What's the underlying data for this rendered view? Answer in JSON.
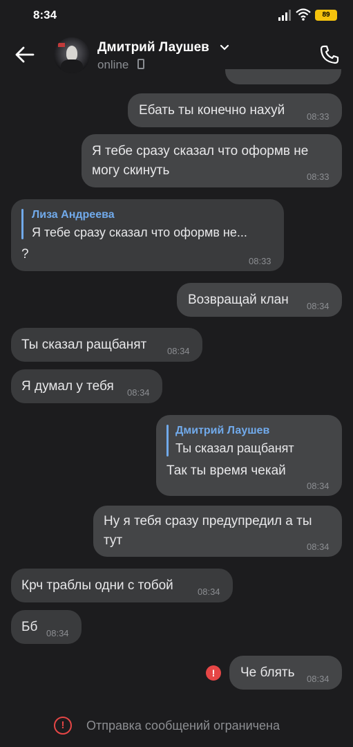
{
  "status_bar": {
    "time": "8:34",
    "battery": "89"
  },
  "header": {
    "contact_name": "Дмитрий Лаушев",
    "status": "online",
    "icons": [
      "back-arrow-icon",
      "chevron-down-icon",
      "mobile-phone-icon",
      "call-icon"
    ]
  },
  "messages": [
    {
      "direction": "out",
      "text": "Ебать ты конечно нахуй",
      "time": "08:33"
    },
    {
      "direction": "out",
      "line1": "Я тебе сразу  сказал что оформв не",
      "line2": "могу скинуть",
      "time": "08:33"
    },
    {
      "direction": "in",
      "reply_name": "Лиза Андреева",
      "reply_text": "Я тебе сразу  сказал что оформв не...",
      "text": "?",
      "time": "08:33"
    },
    {
      "direction": "out",
      "text": "Возвращай клан",
      "time": "08:34"
    },
    {
      "direction": "in",
      "text": "Ты сказал ращбанят",
      "time": "08:34"
    },
    {
      "direction": "in",
      "text": "Я думал у тебя",
      "time": "08:34"
    },
    {
      "direction": "out",
      "reply_name": "Дмитрий Лаушев",
      "reply_text": "Ты сказал ращбанят",
      "text": "Так ты время чекай",
      "time": "08:34"
    },
    {
      "direction": "out",
      "line1": "Ну я тебя сразу предупредил а ты",
      "line2": "тут",
      "time": "08:34"
    },
    {
      "direction": "in",
      "text": "Крч траблы одни с тобой",
      "time": "08:34"
    },
    {
      "direction": "in",
      "text": "Бб",
      "time": "08:34"
    },
    {
      "direction": "out",
      "text": "Че блять",
      "time": "08:34",
      "failed": true
    }
  ],
  "footer": {
    "notice": "Отправка сообщений ограничена"
  },
  "colors": {
    "background": "#1c1c1e",
    "bubble_in": "#3a3b3d",
    "bubble_out": "#444547",
    "accent": "#71aaeb",
    "error": "#e64646"
  }
}
